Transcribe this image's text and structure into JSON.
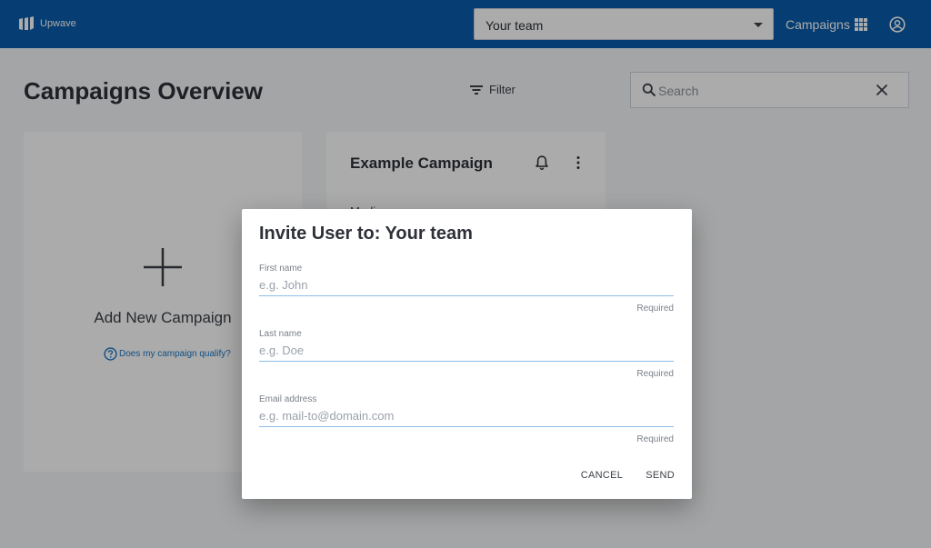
{
  "header": {
    "brand": "Upwave",
    "team_select": "Your team",
    "nav_campaigns": "Campaigns",
    "icons": [
      "upwave-logo-icon",
      "chevron-down-icon",
      "apps-grid-icon",
      "account-circle-icon"
    ]
  },
  "page": {
    "title": "Campaigns Overview",
    "filter_label": "Filter",
    "search_placeholder": "Search"
  },
  "cards": {
    "add_label": "Add New Campaign",
    "qualify_link": "Does my campaign qualify?",
    "campaign_title": "Example Campaign",
    "campaign_media_label": "Media"
  },
  "dialog": {
    "title": "Invite User to: Your team",
    "fields": [
      {
        "label": "First name",
        "placeholder": "e.g. John",
        "value": "",
        "helper": "Required"
      },
      {
        "label": "Last name",
        "placeholder": "e.g. Doe",
        "value": "",
        "helper": "Required"
      },
      {
        "label": "Email address",
        "placeholder": "e.g. mail-to@domain.com",
        "value": "",
        "helper": "Required"
      }
    ],
    "cancel_label": "CANCEL",
    "send_label": "SEND"
  },
  "colors": {
    "topbar": "#0a5bab",
    "accent": "#1b76c4",
    "input_underline": "#8fbde6"
  }
}
